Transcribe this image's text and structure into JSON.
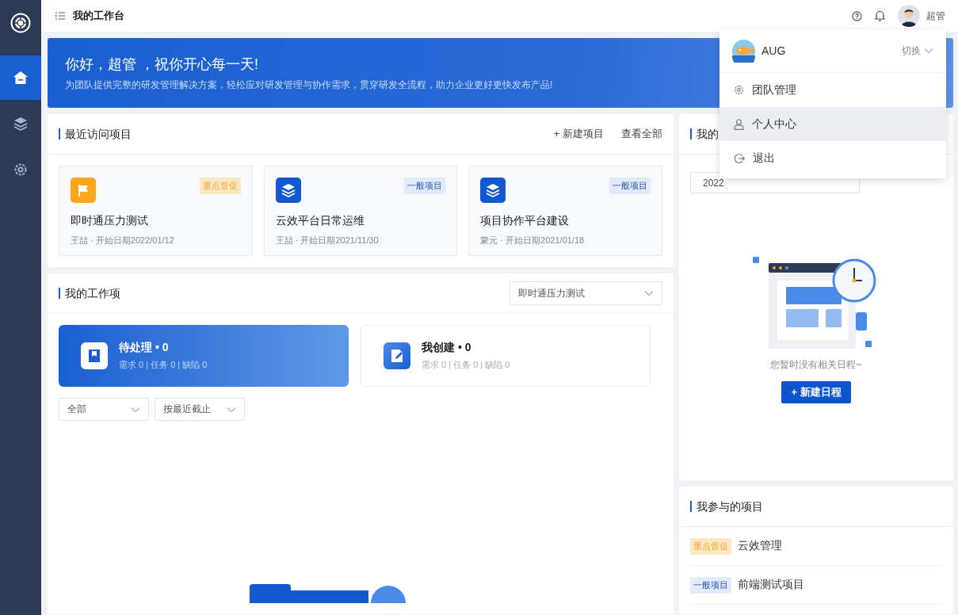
{
  "sidebar": {
    "items": [
      {
        "kind": "logo",
        "selected": false
      },
      {
        "kind": "home",
        "selected": true
      },
      {
        "kind": "layers",
        "selected": false
      },
      {
        "kind": "settings",
        "selected": false
      }
    ]
  },
  "header": {
    "title": "我的工作台",
    "user_name": "超管"
  },
  "banner": {
    "greeting": "你好，超管 ，祝你开心每一天!",
    "subtitle": "为团队提供完整的研发管理解决方案，轻松应对研发管理与协作需求，贯穿研发全流程，助力企业更好更快发布产品!"
  },
  "recent": {
    "title": "最近访问项目",
    "actions": [
      "+ 新建项目",
      "查看全部"
    ],
    "projects": [
      {
        "kind": "key",
        "tag": "重点督促",
        "name": "即时通压力测试",
        "meta": "王喆 · 开始日期2022/01/12"
      },
      {
        "kind": "normal",
        "tag": "一般项目",
        "name": "云效平台日常运维",
        "meta": "王喆 · 开始日期2021/11/30"
      },
      {
        "kind": "normal",
        "tag": "一般项目",
        "name": "项目协作平台建设",
        "meta": "蒙元 · 开始日期2021/01/18"
      }
    ]
  },
  "work": {
    "title": "我的工作项",
    "project_select": "即时通压力测试",
    "tabs": [
      {
        "label": "待处理 • 0",
        "stats": "需求 0 | 任务 0 | 缺陷 0",
        "selected": true
      },
      {
        "label": "我创建 • 0",
        "stats": "需求 0 | 任务 0 | 缺陷 0",
        "selected": false
      }
    ],
    "filters": [
      "全部",
      "按最近截止"
    ]
  },
  "schedule": {
    "title": "我的",
    "date_value": "2022",
    "empty_text": "您暂时没有相关日程~",
    "button": "+ 新建日程"
  },
  "joined": {
    "title": "我参与的项目",
    "items": [
      {
        "kind": "key",
        "tag": "重点督促",
        "name": "云效管理"
      },
      {
        "kind": "normal",
        "tag": "一般项目",
        "name": "前端测试项目"
      }
    ]
  },
  "menu": {
    "account": {
      "name": "AUG",
      "switch_label": "切换"
    },
    "items": [
      {
        "label": "团队管理",
        "selected": false
      },
      {
        "label": "个人中心",
        "selected": true
      },
      {
        "label": "退出",
        "selected": false
      }
    ]
  }
}
